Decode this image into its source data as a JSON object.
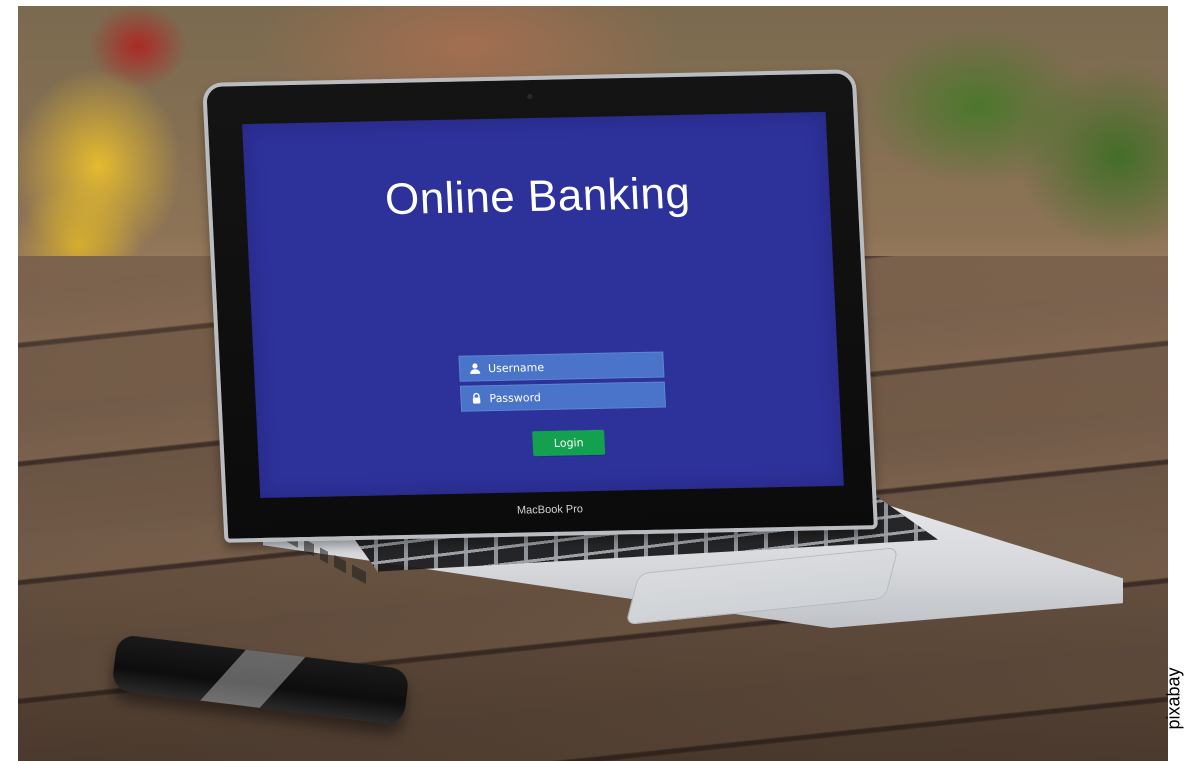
{
  "screen": {
    "title": "Online Banking",
    "username_placeholder": "Username",
    "password_placeholder": "Password",
    "login_label": "Login",
    "accent": {
      "screen_bg": "#2d319a",
      "field_bg": "#4a74c9",
      "login_bg": "#13a04f"
    }
  },
  "laptop": {
    "brand_label": "MacBook Pro"
  },
  "watermark": {
    "text": "pixabay"
  },
  "icons": {
    "username": "user-icon",
    "password": "lock-icon"
  }
}
